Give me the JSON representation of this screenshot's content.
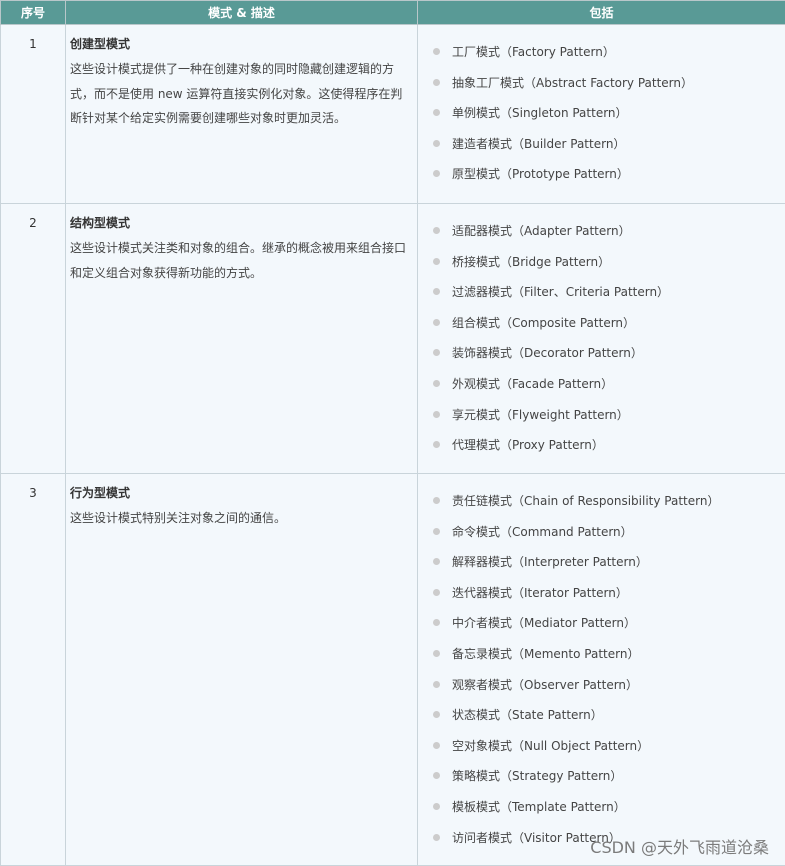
{
  "table": {
    "headers": [
      "序号",
      "模式 & 描述",
      "包括"
    ],
    "rows": [
      {
        "num": "1",
        "category": "创建型模式",
        "description_lines": [
          "这些设计模式提供了一种在创建对象的同时隐藏创建逻辑的方",
          "式，而不是使用 new 运算符直接实例化对象。这使得程序在判",
          "断针对某个给定实例需要创建哪些对象时更加灵活。"
        ],
        "items": [
          "工厂模式（Factory Pattern）",
          "抽象工厂模式（Abstract Factory Pattern）",
          "单例模式（Singleton Pattern）",
          "建造者模式（Builder Pattern）",
          "原型模式（Prototype Pattern）"
        ]
      },
      {
        "num": "2",
        "category": "结构型模式",
        "description_lines": [
          "这些设计模式关注类和对象的组合。继承的概念被用来组合接口",
          "和定义组合对象获得新功能的方式。"
        ],
        "items": [
          "适配器模式（Adapter Pattern）",
          "桥接模式（Bridge Pattern）",
          "过滤器模式（Filter、Criteria Pattern）",
          "组合模式（Composite Pattern）",
          "装饰器模式（Decorator Pattern）",
          "外观模式（Facade Pattern）",
          "享元模式（Flyweight Pattern）",
          "代理模式（Proxy Pattern）"
        ]
      },
      {
        "num": "3",
        "category": "行为型模式",
        "description_lines": [
          "这些设计模式特别关注对象之间的通信。"
        ],
        "items": [
          "责任链模式（Chain of Responsibility Pattern）",
          "命令模式（Command Pattern）",
          "解释器模式（Interpreter Pattern）",
          "迭代器模式（Iterator Pattern）",
          "中介者模式（Mediator Pattern）",
          "备忘录模式（Memento Pattern）",
          "观察者模式（Observer Pattern）",
          "状态模式（State Pattern）",
          "空对象模式（Null Object Pattern）",
          "策略模式（Strategy Pattern）",
          "模板模式（Template Pattern）",
          "访问者模式（Visitor Pattern）"
        ]
      }
    ]
  },
  "watermark": "CSDN @天外飞雨道沧桑",
  "colors": {
    "header_bg": "#599a96",
    "cell_bg": "#f3f8fc",
    "bullet": "#cccccc"
  }
}
